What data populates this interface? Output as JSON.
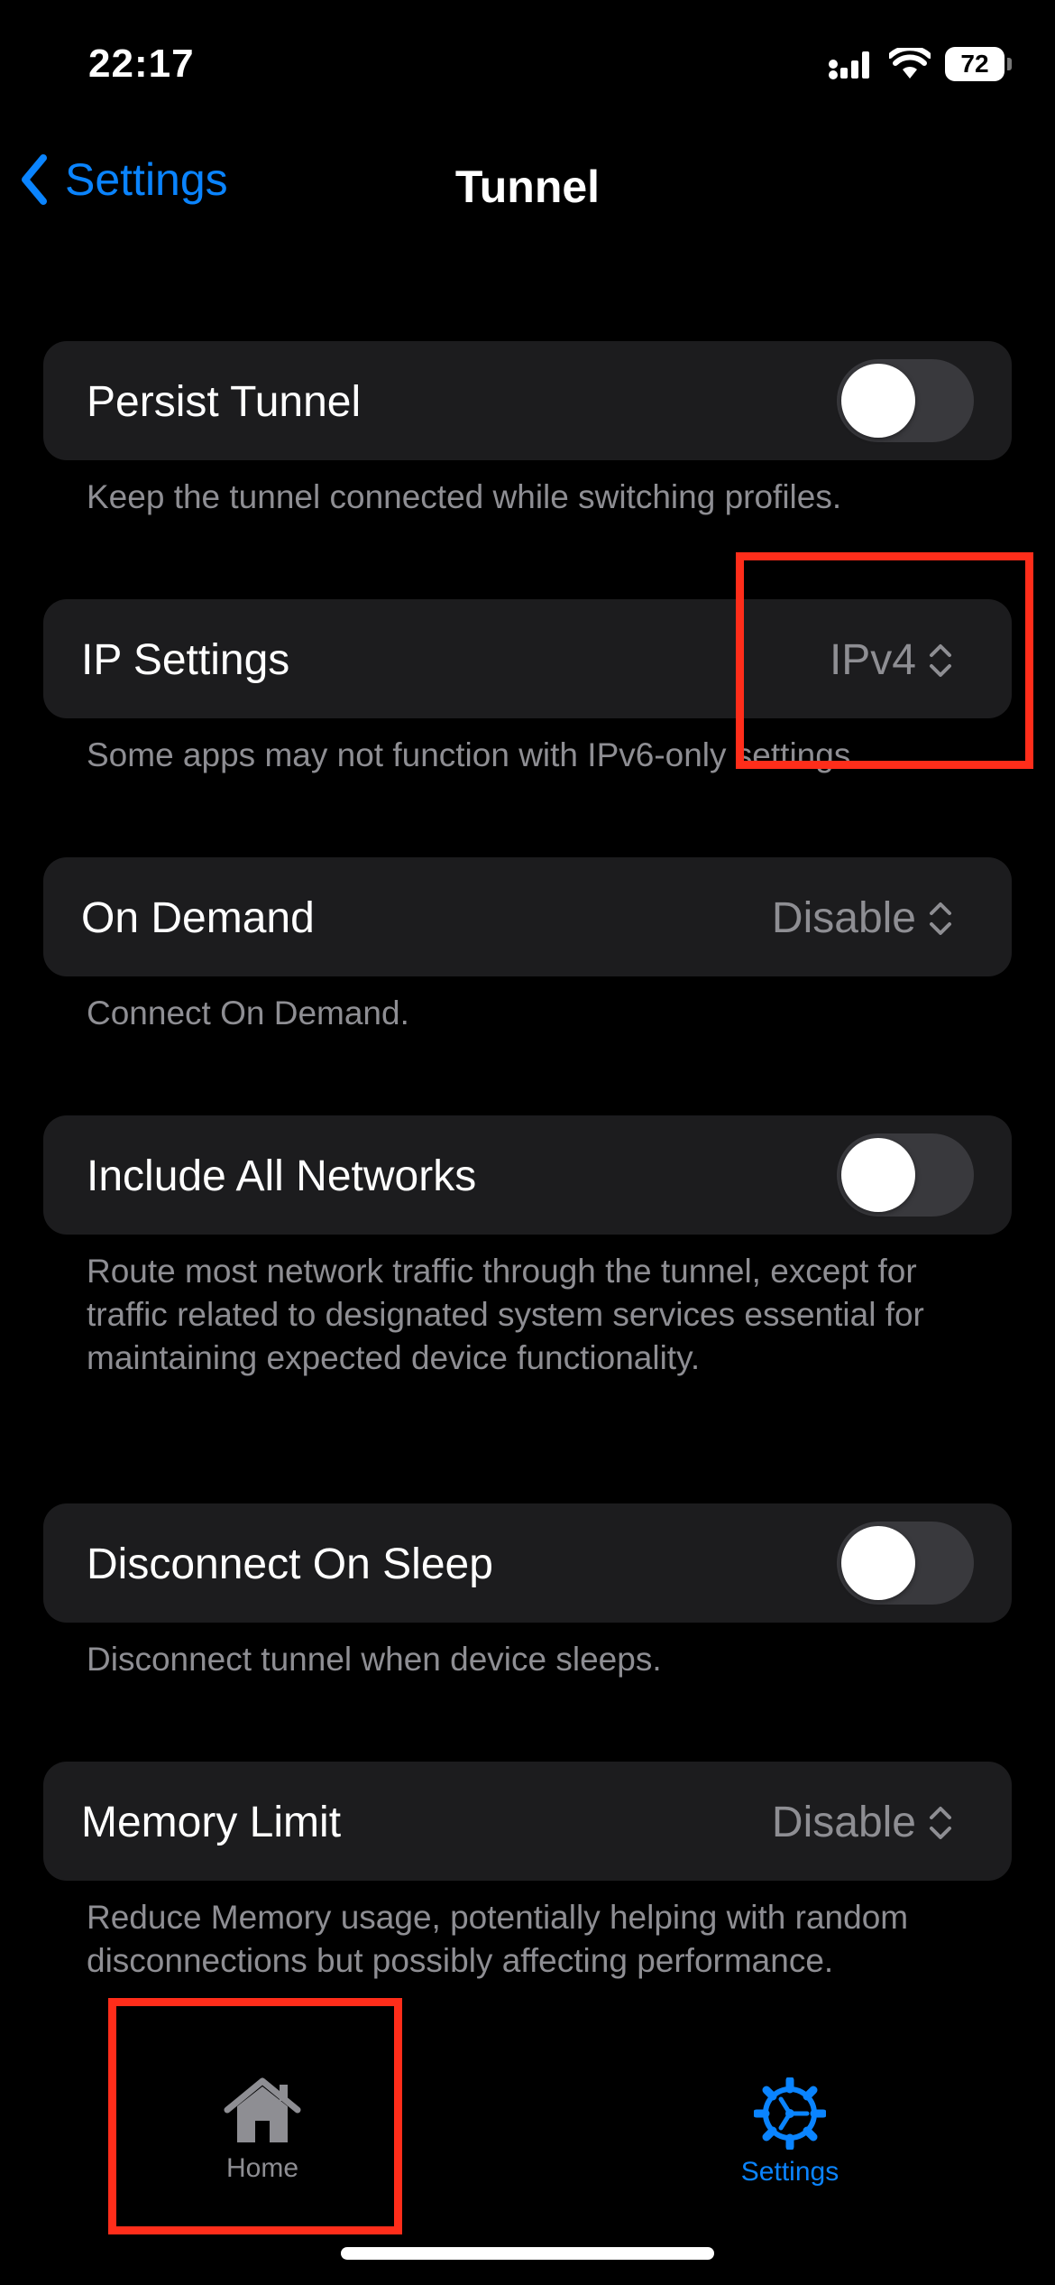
{
  "status": {
    "time": "22:17",
    "battery": "72"
  },
  "nav": {
    "back_label": "Settings",
    "title": "Tunnel"
  },
  "settings": {
    "persist_tunnel": {
      "label": "Persist Tunnel",
      "enabled": false,
      "footer": "Keep the tunnel connected while switching profiles."
    },
    "ip_settings": {
      "label": "IP Settings",
      "value": "IPv4",
      "footer": "Some apps may not function with IPv6-only settings."
    },
    "on_demand": {
      "label": "On Demand",
      "value": "Disable",
      "footer": "Connect On Demand."
    },
    "include_all_networks": {
      "label": "Include All Networks",
      "enabled": false,
      "footer": "Route most network traffic through the tunnel, except for traffic related to designated system services essential for maintaining expected device functionality."
    },
    "disconnect_on_sleep": {
      "label": "Disconnect On Sleep",
      "enabled": false,
      "footer": "Disconnect tunnel when device sleeps."
    },
    "memory_limit": {
      "label": "Memory Limit",
      "value": "Disable",
      "footer": "Reduce Memory usage, potentially helping with random disconnections but possibly affecting performance."
    }
  },
  "tabs": {
    "home": "Home",
    "settings": "Settings"
  },
  "colors": {
    "accent": "#0a84ff",
    "highlight": "#ff2d1a",
    "card": "#1c1c1e",
    "secondary_text": "#8e8e93"
  }
}
